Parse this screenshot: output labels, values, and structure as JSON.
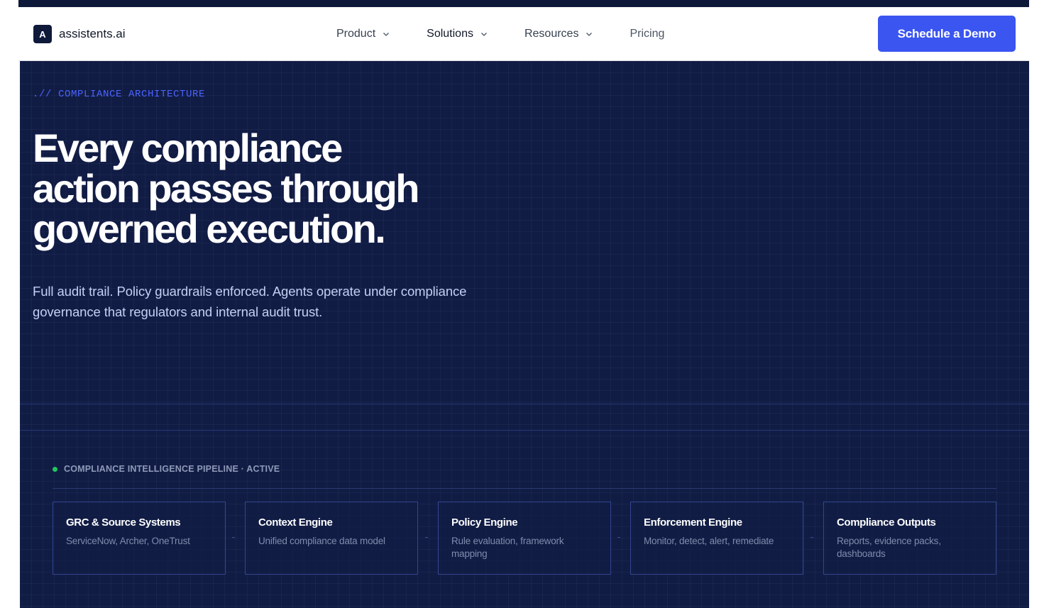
{
  "brand": {
    "logo_letter": "A",
    "name": "assistents.ai"
  },
  "nav": {
    "items": [
      {
        "label": "Product",
        "has_dropdown": true
      },
      {
        "label": "Solutions",
        "has_dropdown": true
      },
      {
        "label": "Resources",
        "has_dropdown": true
      },
      {
        "label": "Pricing",
        "has_dropdown": false
      }
    ],
    "cta_label": "Schedule a Demo"
  },
  "hero": {
    "eyebrow": ".// COMPLIANCE ARCHITECTURE",
    "headline_lines": [
      "Every compliance",
      "action passes through",
      "governed execution."
    ],
    "subhead_lines": [
      "Full audit trail. Policy guardrails enforced. Agents operate under compliance",
      "governance that regulators and internal audit trust."
    ]
  },
  "pipeline": {
    "status_label": "COMPLIANCE INTELLIGENCE PIPELINE · ACTIVE",
    "status_color": "#22c55e",
    "stages": [
      {
        "title": "GRC & Source Systems",
        "desc": "ServiceNow, Archer, OneTrust"
      },
      {
        "title": "Context Engine",
        "desc": "Unified compliance data model"
      },
      {
        "title": "Policy Engine",
        "desc": "Rule evaluation, framework mapping"
      },
      {
        "title": "Enforcement Engine",
        "desc": "Monitor, detect, alert, remediate"
      },
      {
        "title": "Compliance Outputs",
        "desc": "Reports, evidence packs, dashboards"
      }
    ]
  },
  "colors": {
    "accent": "#3b55f0",
    "hero_bg": "#111c45",
    "eyebrow": "#4a63ff"
  }
}
